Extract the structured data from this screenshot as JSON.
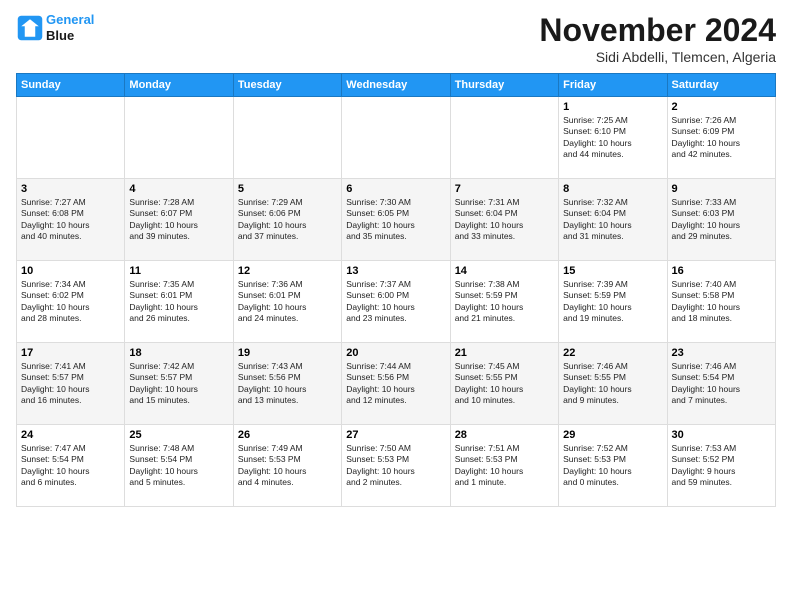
{
  "header": {
    "logo_line1": "General",
    "logo_line2": "Blue",
    "month": "November 2024",
    "location": "Sidi Abdelli, Tlemcen, Algeria"
  },
  "weekdays": [
    "Sunday",
    "Monday",
    "Tuesday",
    "Wednesday",
    "Thursday",
    "Friday",
    "Saturday"
  ],
  "weeks": [
    [
      {
        "day": "",
        "info": ""
      },
      {
        "day": "",
        "info": ""
      },
      {
        "day": "",
        "info": ""
      },
      {
        "day": "",
        "info": ""
      },
      {
        "day": "",
        "info": ""
      },
      {
        "day": "1",
        "info": "Sunrise: 7:25 AM\nSunset: 6:10 PM\nDaylight: 10 hours\nand 44 minutes."
      },
      {
        "day": "2",
        "info": "Sunrise: 7:26 AM\nSunset: 6:09 PM\nDaylight: 10 hours\nand 42 minutes."
      }
    ],
    [
      {
        "day": "3",
        "info": "Sunrise: 7:27 AM\nSunset: 6:08 PM\nDaylight: 10 hours\nand 40 minutes."
      },
      {
        "day": "4",
        "info": "Sunrise: 7:28 AM\nSunset: 6:07 PM\nDaylight: 10 hours\nand 39 minutes."
      },
      {
        "day": "5",
        "info": "Sunrise: 7:29 AM\nSunset: 6:06 PM\nDaylight: 10 hours\nand 37 minutes."
      },
      {
        "day": "6",
        "info": "Sunrise: 7:30 AM\nSunset: 6:05 PM\nDaylight: 10 hours\nand 35 minutes."
      },
      {
        "day": "7",
        "info": "Sunrise: 7:31 AM\nSunset: 6:04 PM\nDaylight: 10 hours\nand 33 minutes."
      },
      {
        "day": "8",
        "info": "Sunrise: 7:32 AM\nSunset: 6:04 PM\nDaylight: 10 hours\nand 31 minutes."
      },
      {
        "day": "9",
        "info": "Sunrise: 7:33 AM\nSunset: 6:03 PM\nDaylight: 10 hours\nand 29 minutes."
      }
    ],
    [
      {
        "day": "10",
        "info": "Sunrise: 7:34 AM\nSunset: 6:02 PM\nDaylight: 10 hours\nand 28 minutes."
      },
      {
        "day": "11",
        "info": "Sunrise: 7:35 AM\nSunset: 6:01 PM\nDaylight: 10 hours\nand 26 minutes."
      },
      {
        "day": "12",
        "info": "Sunrise: 7:36 AM\nSunset: 6:01 PM\nDaylight: 10 hours\nand 24 minutes."
      },
      {
        "day": "13",
        "info": "Sunrise: 7:37 AM\nSunset: 6:00 PM\nDaylight: 10 hours\nand 23 minutes."
      },
      {
        "day": "14",
        "info": "Sunrise: 7:38 AM\nSunset: 5:59 PM\nDaylight: 10 hours\nand 21 minutes."
      },
      {
        "day": "15",
        "info": "Sunrise: 7:39 AM\nSunset: 5:59 PM\nDaylight: 10 hours\nand 19 minutes."
      },
      {
        "day": "16",
        "info": "Sunrise: 7:40 AM\nSunset: 5:58 PM\nDaylight: 10 hours\nand 18 minutes."
      }
    ],
    [
      {
        "day": "17",
        "info": "Sunrise: 7:41 AM\nSunset: 5:57 PM\nDaylight: 10 hours\nand 16 minutes."
      },
      {
        "day": "18",
        "info": "Sunrise: 7:42 AM\nSunset: 5:57 PM\nDaylight: 10 hours\nand 15 minutes."
      },
      {
        "day": "19",
        "info": "Sunrise: 7:43 AM\nSunset: 5:56 PM\nDaylight: 10 hours\nand 13 minutes."
      },
      {
        "day": "20",
        "info": "Sunrise: 7:44 AM\nSunset: 5:56 PM\nDaylight: 10 hours\nand 12 minutes."
      },
      {
        "day": "21",
        "info": "Sunrise: 7:45 AM\nSunset: 5:55 PM\nDaylight: 10 hours\nand 10 minutes."
      },
      {
        "day": "22",
        "info": "Sunrise: 7:46 AM\nSunset: 5:55 PM\nDaylight: 10 hours\nand 9 minutes."
      },
      {
        "day": "23",
        "info": "Sunrise: 7:46 AM\nSunset: 5:54 PM\nDaylight: 10 hours\nand 7 minutes."
      }
    ],
    [
      {
        "day": "24",
        "info": "Sunrise: 7:47 AM\nSunset: 5:54 PM\nDaylight: 10 hours\nand 6 minutes."
      },
      {
        "day": "25",
        "info": "Sunrise: 7:48 AM\nSunset: 5:54 PM\nDaylight: 10 hours\nand 5 minutes."
      },
      {
        "day": "26",
        "info": "Sunrise: 7:49 AM\nSunset: 5:53 PM\nDaylight: 10 hours\nand 4 minutes."
      },
      {
        "day": "27",
        "info": "Sunrise: 7:50 AM\nSunset: 5:53 PM\nDaylight: 10 hours\nand 2 minutes."
      },
      {
        "day": "28",
        "info": "Sunrise: 7:51 AM\nSunset: 5:53 PM\nDaylight: 10 hours\nand 1 minute."
      },
      {
        "day": "29",
        "info": "Sunrise: 7:52 AM\nSunset: 5:53 PM\nDaylight: 10 hours\nand 0 minutes."
      },
      {
        "day": "30",
        "info": "Sunrise: 7:53 AM\nSunset: 5:52 PM\nDaylight: 9 hours\nand 59 minutes."
      }
    ]
  ]
}
